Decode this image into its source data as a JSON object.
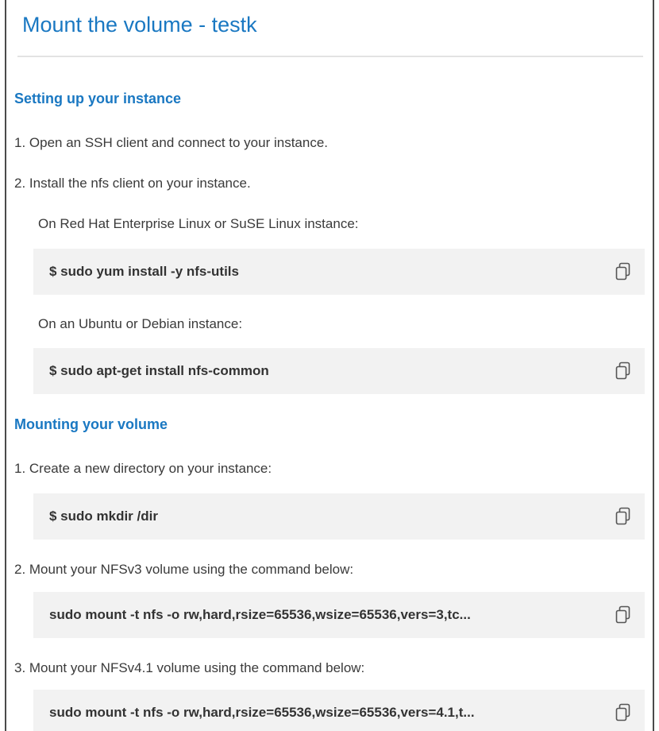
{
  "header": {
    "title": "Mount the volume - testk"
  },
  "setup": {
    "heading": "Setting up your instance",
    "step1": "1. Open an SSH client and connect to your instance.",
    "step2": "2. Install the nfs client on your instance.",
    "rhel_label": "On Red Hat Enterprise Linux or SuSE Linux instance:",
    "rhel_command": "$ sudo yum install -y nfs-utils",
    "ubuntu_label": "On an Ubuntu or Debian instance:",
    "ubuntu_command": "$ sudo apt-get install nfs-common"
  },
  "mounting": {
    "heading": "Mounting your volume",
    "step1": "1. Create a new directory on your instance:",
    "mkdir_command": "$ sudo mkdir /dir",
    "step2": "2. Mount your NFSv3 volume using the command below:",
    "nfsv3_command": "sudo mount -t nfs -o rw,hard,rsize=65536,wsize=65536,vers=3,tc...",
    "step3": "3. Mount your NFSv4.1 volume using the command below:",
    "nfsv41_command": "sudo mount -t nfs -o rw,hard,rsize=65536,wsize=65536,vers=4.1,t..."
  },
  "icons": {
    "copy": "copy-icon"
  },
  "colors": {
    "accent": "#1a78c2",
    "code_bg": "#f2f2f2"
  }
}
